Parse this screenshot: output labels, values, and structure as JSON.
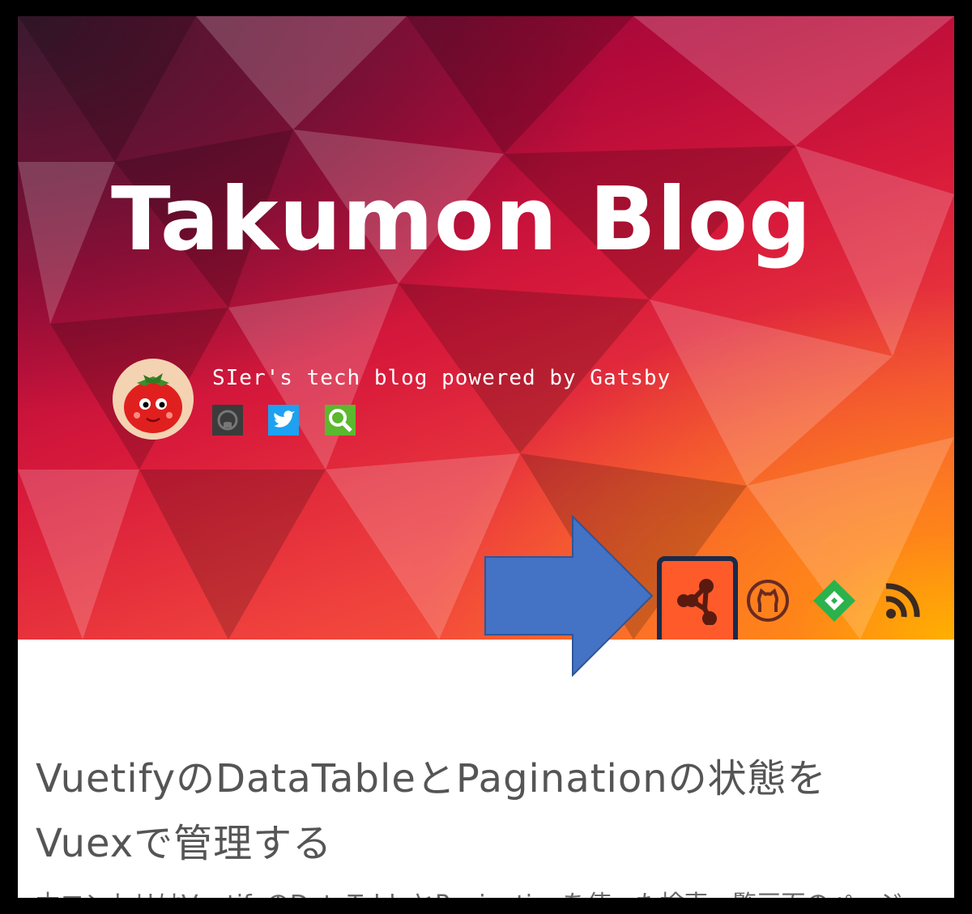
{
  "header": {
    "title": "Takumon Blog",
    "tagline": "SIer's tech blog powered by Gatsby",
    "avatar_icon": "tomato-avatar-icon",
    "social_icons": [
      "github-icon",
      "twitter-icon",
      "search-icon"
    ]
  },
  "toolbar": {
    "icons": [
      "fork-graph-icon",
      "github-icon",
      "feedly-icon",
      "rss-icon"
    ],
    "highlighted": "fork-graph-icon"
  },
  "post": {
    "title_line1": "VuetifyのDataTableとPaginationの状態を",
    "title_line2": "Vuexで管理する",
    "excerpt": "本エントリはVuetifyのDataTableとPaginationを使った検索一覧画面のページ"
  },
  "colors": {
    "hero_dark": "#7a0e3a",
    "hero_red": "#d81a3b",
    "hero_orange": "#ff6a36",
    "hero_yellow": "#ffb000",
    "arrow_blue": "#4472c4",
    "highlight_border": "#1a2a4a",
    "twitter_blue": "#1da1f2",
    "search_green": "#5cb82e",
    "feedly_green": "#2bb24c",
    "text_gray": "#555555"
  }
}
